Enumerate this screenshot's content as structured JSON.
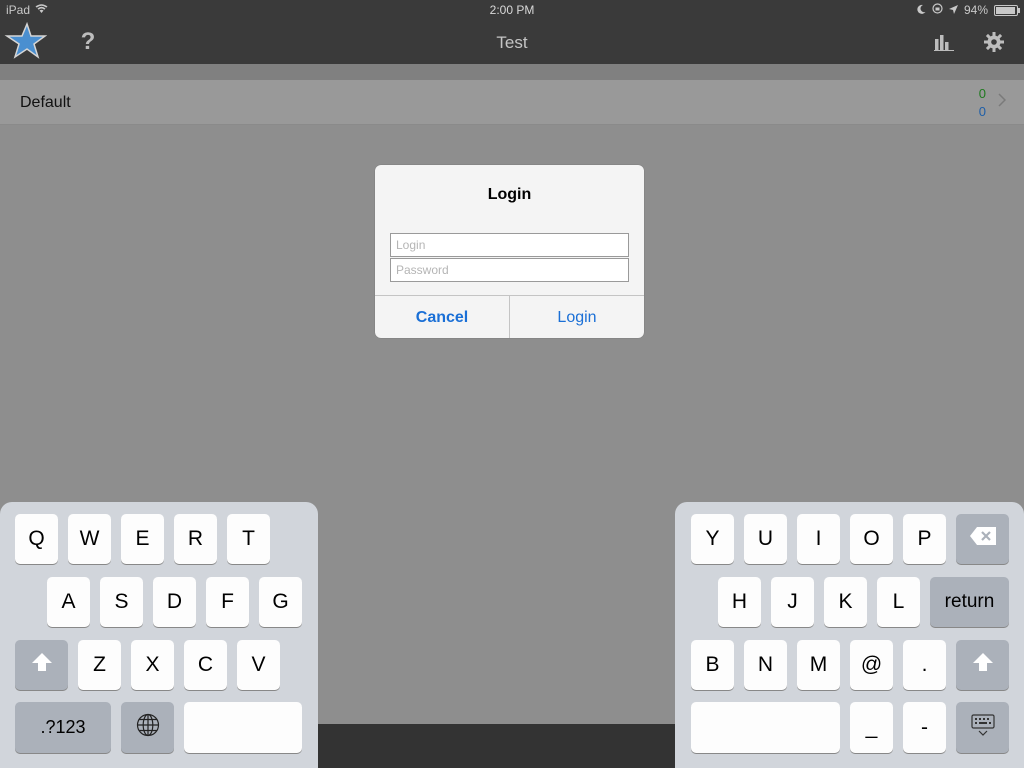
{
  "status_bar": {
    "device": "iPad",
    "time": "2:00 PM",
    "battery": "94%",
    "battery_level": 0.94
  },
  "nav": {
    "title": "Test",
    "left_icons": [
      "star-icon",
      "help-icon"
    ],
    "help_label": "?",
    "right_icons": [
      "chart-icon",
      "gear-icon"
    ]
  },
  "list": {
    "row_label": "Default",
    "count_new": "0",
    "count_review": "0",
    "colors": {
      "new": "#1f7a1f",
      "review": "#1f5fa8"
    }
  },
  "dialog": {
    "title": "Login",
    "login_placeholder": "Login",
    "password_placeholder": "Password",
    "login_value": "",
    "password_value": "",
    "cancel_label": "Cancel",
    "login_label": "Login",
    "accent": "#1a6fd6"
  },
  "keyboard": {
    "left_row1": [
      "Q",
      "W",
      "E",
      "R",
      "T"
    ],
    "left_row2": [
      "A",
      "S",
      "D",
      "F",
      "G"
    ],
    "left_row3": [
      "Z",
      "X",
      "C",
      "V"
    ],
    "left_numbers_label": ".?123",
    "right_row1": [
      "Y",
      "U",
      "I",
      "O",
      "P"
    ],
    "right_row2": [
      "H",
      "J",
      "K",
      "L"
    ],
    "right_return_label": "return",
    "right_row3": [
      "B",
      "N",
      "M",
      "@",
      "."
    ],
    "right_row4": [
      "_",
      "-"
    ],
    "icons": [
      "shift-icon",
      "globe-icon",
      "backspace-icon",
      "keyboard-hide-icon"
    ]
  }
}
